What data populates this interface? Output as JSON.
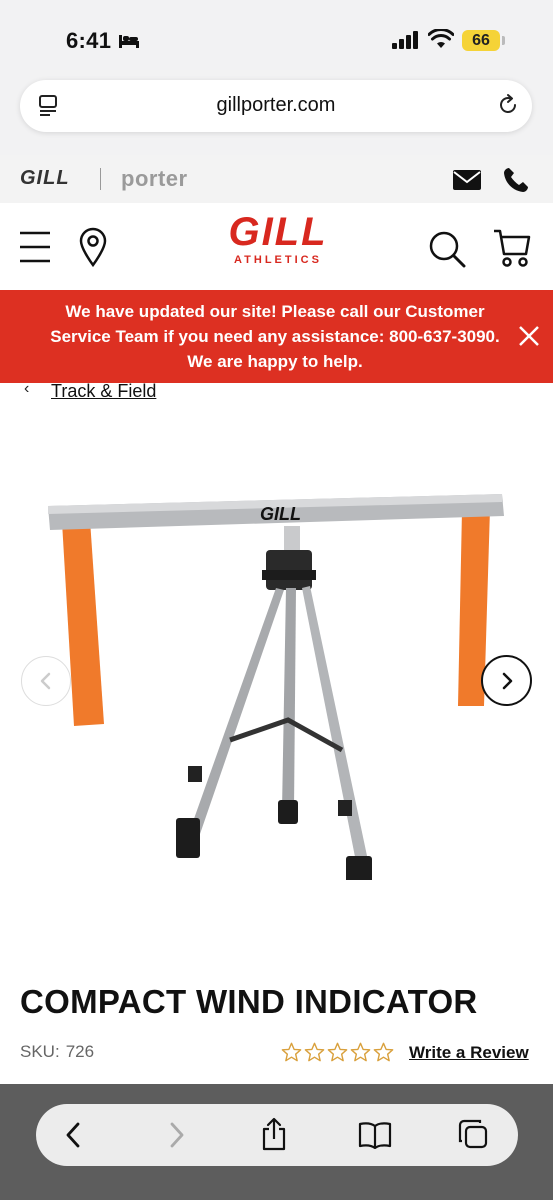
{
  "status_bar": {
    "time": "6:41",
    "battery": "66"
  },
  "browser": {
    "url": "gillporter.com"
  },
  "brand_strip": {
    "gill": "GILL",
    "porter": "porter"
  },
  "header": {
    "logo_main": "GILL",
    "logo_sub": "ATHLETICS"
  },
  "notice": {
    "text": "We have updated our site! Please call our Customer Service Team if you need any assistance: 800-637-3090. We are happy to help."
  },
  "breadcrumb": {
    "chevron": "‹",
    "label": "Track & Field"
  },
  "product": {
    "image_logo": "GILL",
    "title": "COMPACT WIND INDICATOR",
    "sku_label": "SKU:",
    "sku": "726",
    "rating_stars": 5,
    "rating_value": 0,
    "write_review": "Write a Review"
  },
  "colors": {
    "brand_red": "#d8281f",
    "banner_red": "#dd3022",
    "flag_orange": "#f07a2b"
  },
  "icons": [
    "bed-icon",
    "signal-icon",
    "wifi-icon",
    "reader-icon",
    "reload-icon",
    "mail-icon",
    "phone-icon",
    "menu-icon",
    "location-icon",
    "search-icon",
    "cart-icon",
    "close-icon",
    "star-icon",
    "back-icon",
    "forward-icon",
    "share-icon",
    "bookmarks-icon",
    "tabs-icon"
  ]
}
